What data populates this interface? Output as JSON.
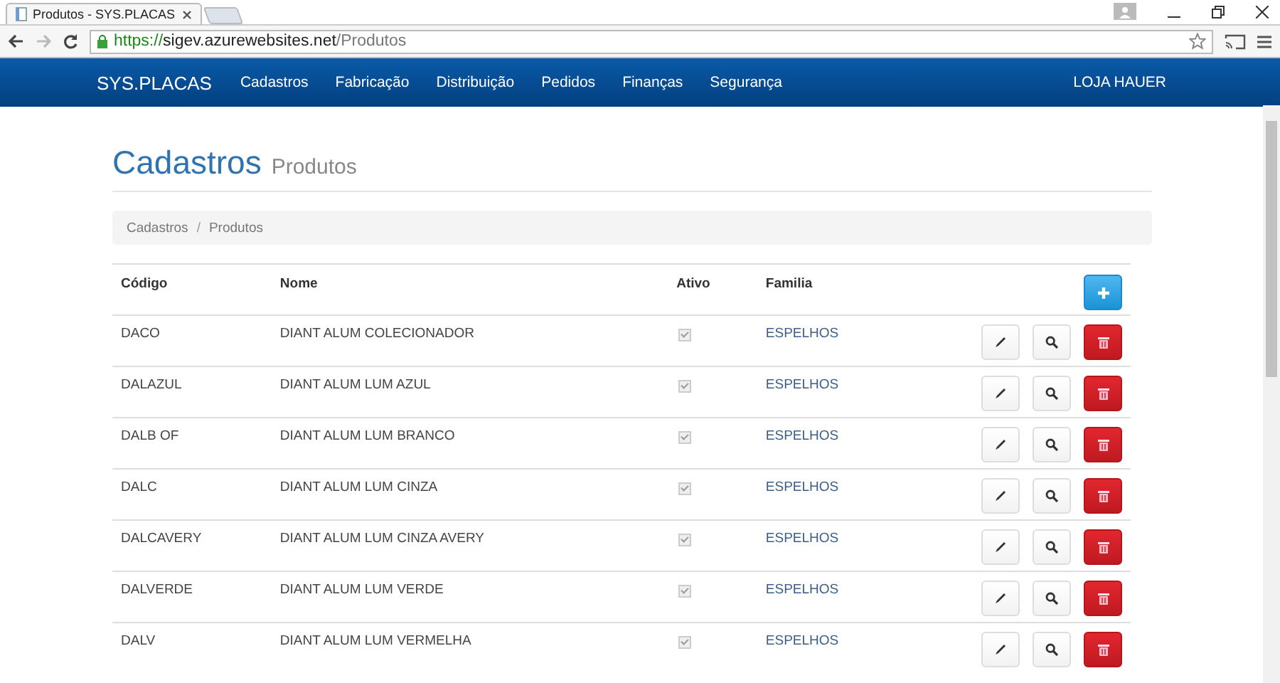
{
  "browser": {
    "tab_title": "Produtos - SYS.PLACAS",
    "url": {
      "scheme": "https://",
      "host": "sigev.azurewebsites.net",
      "path": "/Produtos"
    }
  },
  "navbar": {
    "brand": "SYS.PLACAS",
    "items": [
      "Cadastros",
      "Fabricação",
      "Distribuição",
      "Pedidos",
      "Finanças",
      "Segurança"
    ],
    "user": "LOJA HAUER"
  },
  "header": {
    "title": "Cadastros",
    "subtitle": "Produtos"
  },
  "breadcrumb": {
    "items": [
      "Cadastros",
      "Produtos"
    ],
    "separator": "/"
  },
  "table": {
    "columns": [
      "Código",
      "Nome",
      "Ativo",
      "Familia"
    ],
    "rows": [
      {
        "codigo": "DACO",
        "nome": "DIANT ALUM COLECIONADOR",
        "ativo": true,
        "familia": "ESPELHOS"
      },
      {
        "codigo": "DALAZUL",
        "nome": "DIANT ALUM LUM AZUL",
        "ativo": true,
        "familia": "ESPELHOS"
      },
      {
        "codigo": "DALB OF",
        "nome": "DIANT ALUM LUM BRANCO",
        "ativo": true,
        "familia": "ESPELHOS"
      },
      {
        "codigo": "DALC",
        "nome": "DIANT ALUM LUM CINZA",
        "ativo": true,
        "familia": "ESPELHOS"
      },
      {
        "codigo": "DALCAVERY",
        "nome": "DIANT ALUM LUM CINZA AVERY",
        "ativo": true,
        "familia": "ESPELHOS"
      },
      {
        "codigo": "DALVERDE",
        "nome": "DIANT ALUM LUM VERDE",
        "ativo": true,
        "familia": "ESPELHOS"
      },
      {
        "codigo": "DALV",
        "nome": "DIANT ALUM LUM VERMELHA",
        "ativo": true,
        "familia": "ESPELHOS"
      }
    ]
  }
}
